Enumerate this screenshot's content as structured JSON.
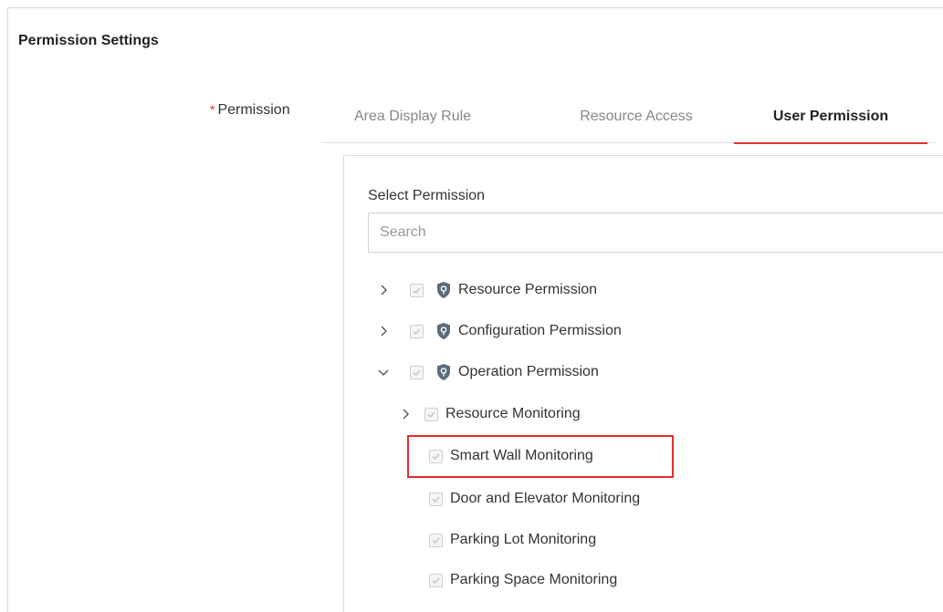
{
  "section": {
    "title": "Permission Settings"
  },
  "field": {
    "required_mark": "*",
    "label": "Permission"
  },
  "tabs": [
    {
      "label": "Area Display Rule",
      "active": false
    },
    {
      "label": "Resource Access",
      "active": false
    },
    {
      "label": "User Permission",
      "active": true
    }
  ],
  "panel": {
    "label": "Select Permission",
    "search_placeholder": "Search"
  },
  "tree": {
    "items": [
      {
        "label": "Resource Permission",
        "expander": "chevron-right-icon",
        "checked": true,
        "icon": "shield-icon"
      },
      {
        "label": "Configuration Permission",
        "expander": "chevron-right-icon",
        "checked": true,
        "icon": "shield-icon"
      },
      {
        "label": "Operation Permission",
        "expander": "chevron-down-icon",
        "checked": true,
        "icon": "shield-icon"
      }
    ],
    "children": [
      {
        "label": "Resource Monitoring",
        "expander": "chevron-right-icon",
        "checked": true
      },
      {
        "label": "Smart Wall Monitoring",
        "checked": true,
        "highlighted": true
      },
      {
        "label": "Door and Elevator Monitoring",
        "checked": true
      },
      {
        "label": "Parking Lot Monitoring",
        "checked": true
      },
      {
        "label": "Parking Space Monitoring",
        "checked": true
      }
    ]
  },
  "colors": {
    "accent": "#e0302b",
    "shield": "#5b6b7b",
    "check_disabled": "#c8c8c8"
  }
}
